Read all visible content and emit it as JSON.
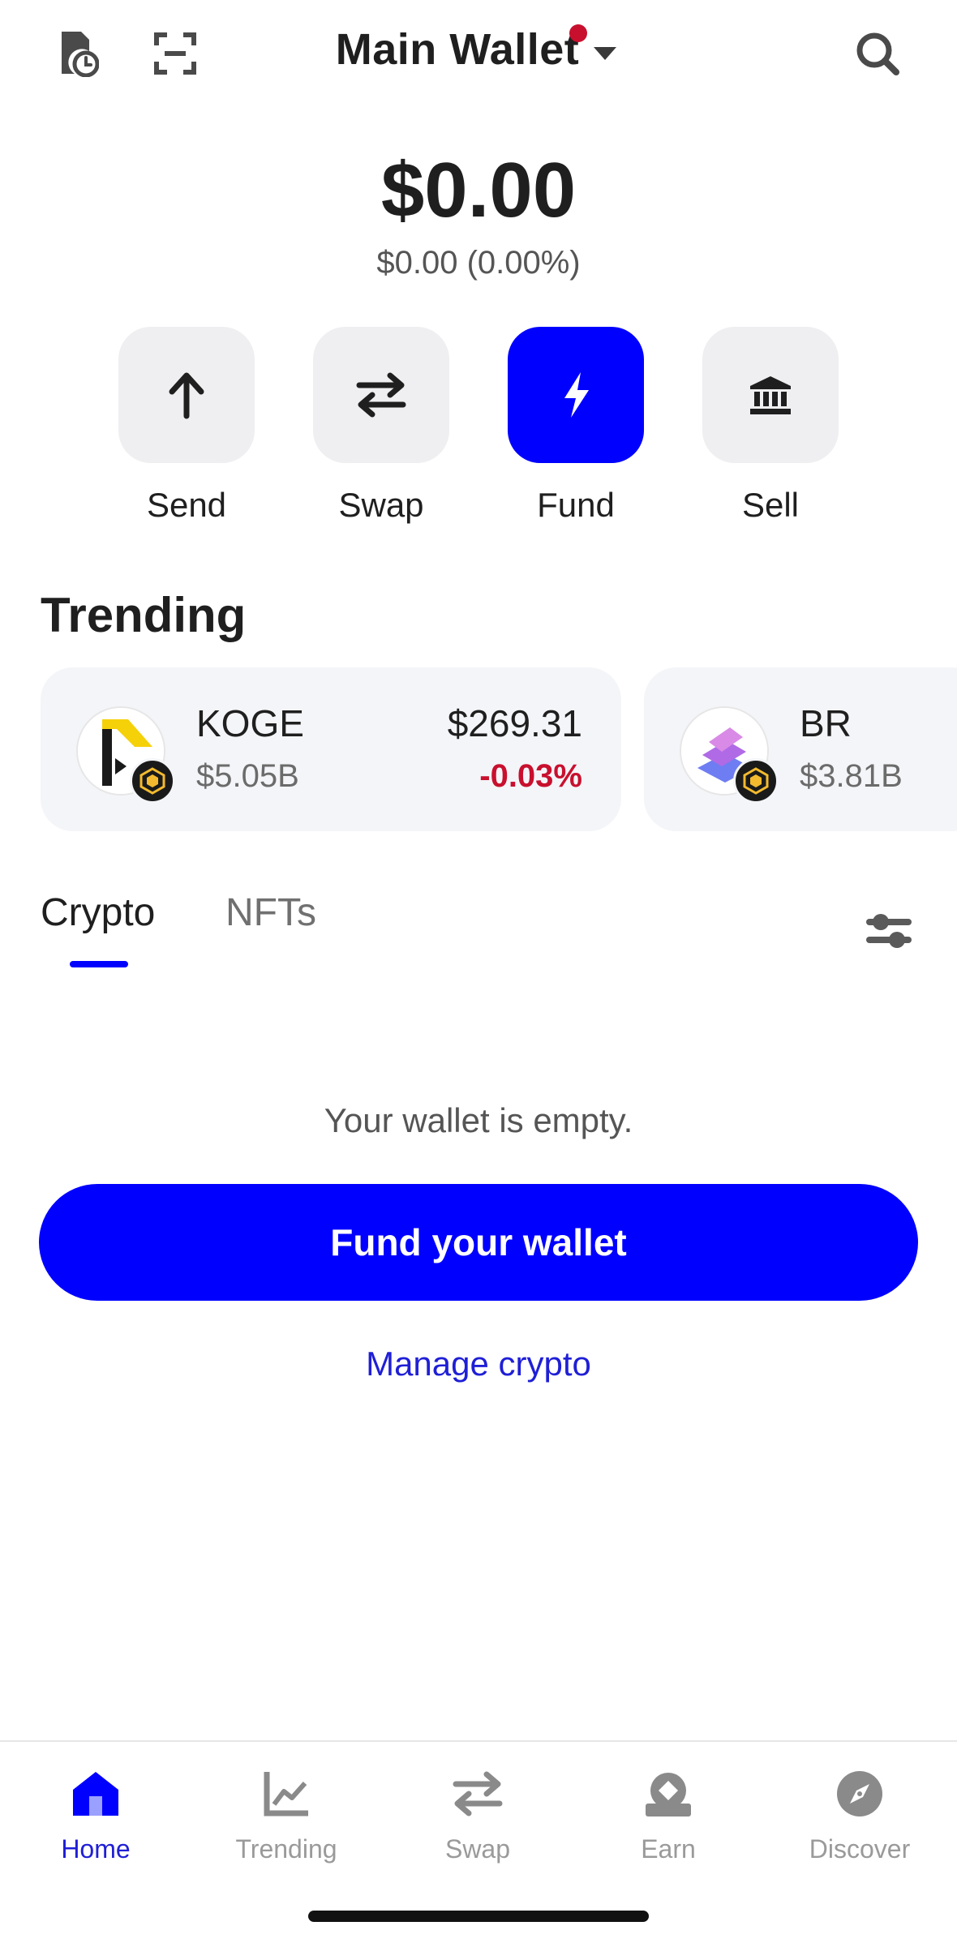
{
  "header": {
    "wallet_name": "Main Wallet",
    "icons": [
      "history-icon",
      "scan-icon",
      "search-icon"
    ]
  },
  "balance": {
    "total": "$0.00",
    "change": "$0.00 (0.00%)"
  },
  "actions": [
    {
      "label": "Send",
      "icon": "arrow-up-icon"
    },
    {
      "label": "Swap",
      "icon": "swap-icon"
    },
    {
      "label": "Fund",
      "icon": "lightning-icon",
      "primary": true
    },
    {
      "label": "Sell",
      "icon": "bank-icon"
    }
  ],
  "trending": {
    "title": "Trending",
    "items": [
      {
        "symbol": "KOGE",
        "market_cap": "$5.05B",
        "price": "$269.31",
        "change": "-0.03%"
      },
      {
        "symbol": "BR",
        "market_cap": "$3.81B"
      }
    ]
  },
  "tabs": [
    {
      "label": "Crypto",
      "active": true
    },
    {
      "label": "NFTs",
      "active": false
    }
  ],
  "empty_state": {
    "message": "Your wallet is empty.",
    "fund_button": "Fund your wallet",
    "manage_link": "Manage crypto"
  },
  "bottom_nav": [
    {
      "label": "Home",
      "icon": "home-icon",
      "active": true
    },
    {
      "label": "Trending",
      "icon": "chart-icon",
      "active": false
    },
    {
      "label": "Swap",
      "icon": "swap-icon",
      "active": false
    },
    {
      "label": "Earn",
      "icon": "earn-icon",
      "active": false
    },
    {
      "label": "Discover",
      "icon": "compass-icon",
      "active": false
    }
  ],
  "colors": {
    "accent": "#0000FF",
    "negative": "#C8102E",
    "notification": "#C8102E"
  }
}
